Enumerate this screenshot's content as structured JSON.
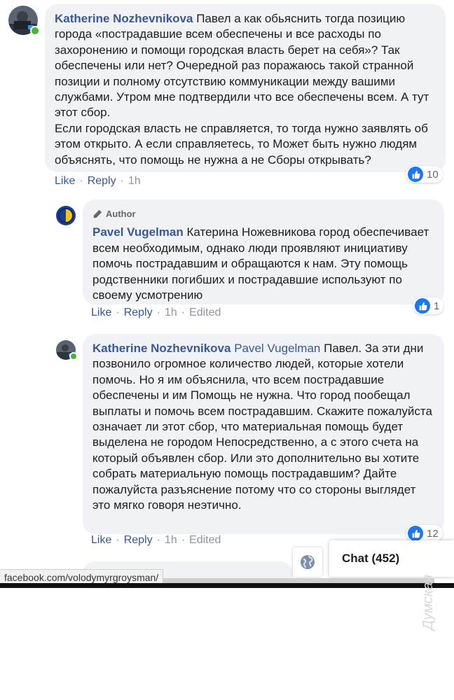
{
  "comments": [
    {
      "author": "Katherine Nozhevnikova",
      "text": "Павел а как обьяснить тогда позицию города «пострадавшие всем обеспечены и все расходы по захоронению и помощи городская власть берет на себя»? Так обеспечены или нет? Очередной раз поражаюсь такой странной позиции и полному отсутствию коммуникации между вашими службами. Утром мне подтвердили что все обеспечены всем. А тут этот сбор.\nЕсли городская власть не справляется, то тогда нужно заявлять об этом открыто. А если справляетесь, то Может быть нужно людям объяснять, что помощь не нужна а не Сборы открывать?",
      "likes": "10",
      "actions": {
        "like": "Like",
        "reply": "Reply",
        "time": "1h"
      }
    },
    {
      "badge": "Author",
      "author": "Pavel Vugelman",
      "text": "Катерина Ножевникова город обеспечивает всем необходимым, однако люди проявляют инициативу помочь пострадавшим и обращаются к нам. Эту помощь родственники погибших и пострадавшие используют по своему усмотрению",
      "likes": "1",
      "actions": {
        "like": "Like",
        "reply": "Reply",
        "time": "1h",
        "edited": "Edited"
      }
    },
    {
      "author": "Katherine Nozhevnikova",
      "mention": "Pavel Vugelman",
      "text": "Павел. За эти дни позвонило огромное количество людей, которые хотели помочь. Но я им объяснила, что всем пострадавшие обеспечены и им Помощь не нужна. Что город пообещал выплаты и помочь всем пострадавшим. Скажите пожалуйста означает ли этот сбор, что материальная помощь будет выделена не городом Непосредственно, а с этого счета на который объявлен сбор. Или это дополнительно вы хотите собрать материальную помощь пострадавшим? Дайте пожалуйста разъяснение потому что со стороны выглядет это мягко говоря неэтично.",
      "likes": "12",
      "actions": {
        "like": "Like",
        "reply": "Reply",
        "time": "1h",
        "edited": "Edited"
      }
    }
  ],
  "separator": "·",
  "chat": {
    "label": "Chat (452)"
  },
  "status_url": "facebook.com/volodymyrgroysman/",
  "watermark": "Думская",
  "icons": {
    "like": "thumbs-up-icon",
    "author": "pencil-icon",
    "globe": "globe-icon"
  },
  "colors": {
    "link": "#385898",
    "like_blue": "#1877f2",
    "bubble": "#f0f2f5",
    "online": "#42b72a"
  }
}
